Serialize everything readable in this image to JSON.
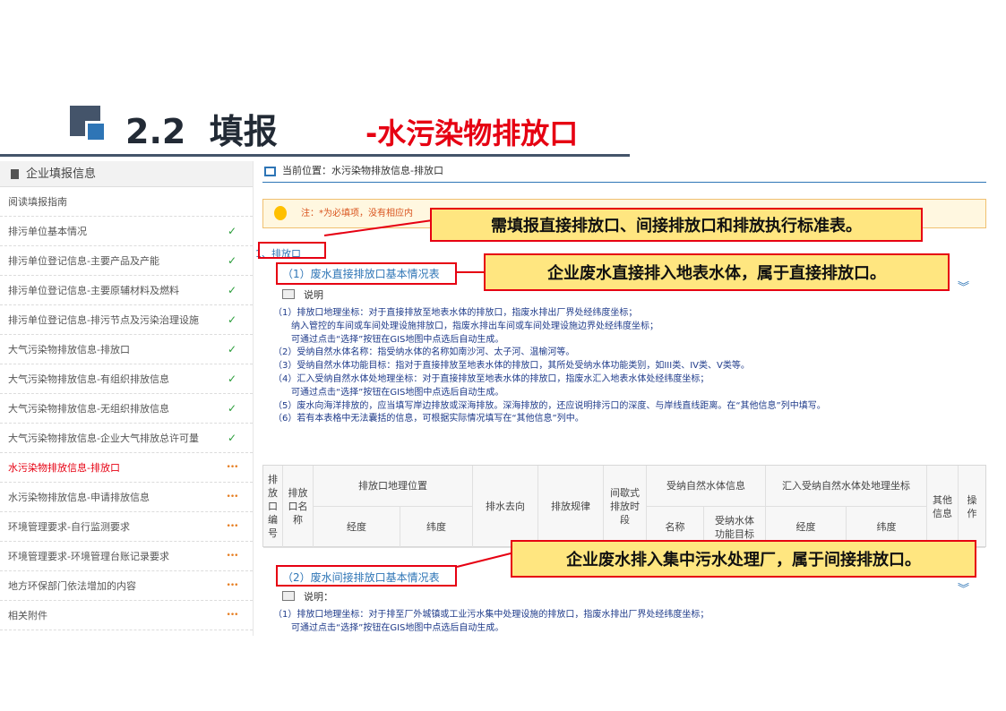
{
  "slide": {
    "number": "2.2",
    "title_main": "填报",
    "title_accent": "-水污染物排放口"
  },
  "sidebar": {
    "header": "企业填报信息",
    "items": [
      {
        "label": "阅读填报指南",
        "status": ""
      },
      {
        "label": "排污单位基本情况",
        "status": "✓"
      },
      {
        "label": "排污单位登记信息-主要产品及产能",
        "status": "✓"
      },
      {
        "label": "排污单位登记信息-主要原辅材料及燃料",
        "status": "✓"
      },
      {
        "label": "排污单位登记信息-排污节点及污染治理设施",
        "status": "✓"
      },
      {
        "label": "大气污染物排放信息-排放口",
        "status": "✓"
      },
      {
        "label": "大气污染物排放信息-有组织排放信息",
        "status": "✓"
      },
      {
        "label": "大气污染物排放信息-无组织排放信息",
        "status": "✓"
      },
      {
        "label": "大气污染物排放信息-企业大气排放总许可量",
        "status": "✓"
      },
      {
        "label": "水污染物排放信息-排放口",
        "status": "•••"
      },
      {
        "label": "水污染物排放信息-申请排放信息",
        "status": "•••"
      },
      {
        "label": "环境管理要求-自行监测要求",
        "status": "•••"
      },
      {
        "label": "环境管理要求-环境管理台账记录要求",
        "status": "•••"
      },
      {
        "label": "地方环保部门依法增加的内容",
        "status": "•••"
      },
      {
        "label": "相关附件",
        "status": "•••"
      }
    ]
  },
  "main": {
    "breadcrumb": "当前位置：水污染物排放信息-排放口",
    "notice": "注：*为必填项，没有相应内",
    "section1": "1、排放口",
    "direct_title": "（1）废水直接排放口基本情况表",
    "note_label": "说明",
    "direct_notes": [
      "（1）排放口地理坐标：对于直接排放至地表水体的排放口，指废水排出厂界处经纬度坐标；",
      "　　纳入管控的车间或车间处理设施排放口，指废水排出车间或车间处理设施边界处经纬度坐标；",
      "　　可通过点击“选择”按钮在GIS地图中点选后自动生成。",
      "（2）受纳自然水体名称：指受纳水体的名称如南沙河、太子河、温榆河等。",
      "（3）受纳自然水体功能目标：指对于直接排放至地表水体的排放口，其所处受纳水体功能类别，如III类、IV类、V类等。",
      "（4）汇入受纳自然水体处地理坐标：对于直接排放至地表水体的排放口，指废水汇入地表水体处经纬度坐标；",
      "　　可通过点击“选择”按钮在GIS地图中点选后自动生成。",
      "（5）废水向海洋排放的，应当填写岸边排放或深海排放。深海排放的，还应说明排污口的深度、与岸线直线距离。在“其他信息”列中填写。",
      "（6）若有本表格中无法囊括的信息，可根据实际情况填写在“其他信息”列中。"
    ],
    "table_headers": {
      "outlet_no": "排放口编号",
      "outlet_name": "排放口名称",
      "geo": "排放口地理位置",
      "lon": "经度",
      "lat": "纬度",
      "destination": "排水去向",
      "pattern": "排放规律",
      "intermittent": "间歇式排放时段",
      "receiving": "受纳自然水体信息",
      "recv_name": "名称",
      "recv_target": "受纳水体功能目标",
      "inflow_geo": "汇入受纳自然水体处地理坐标",
      "inflow_lon": "经度",
      "inflow_lat": "纬度",
      "other": "其他信息",
      "ops": "操作"
    },
    "indirect_title": "（2）废水间接排放口基本情况表",
    "indirect_note_label": "说明：",
    "indirect_notes": [
      "（1）排放口地理坐标：对于排至厂外城镇或工业污水集中处理设施的排放口，指废水排出厂界处经纬度坐标；",
      "　　可通过点击“选择”按钮在GIS地图中点选后自动生成。"
    ]
  },
  "callouts": {
    "c1": "需填报直接排放口、间接排放口和排放执行标准表。",
    "c2": "企业废水直接排入地表水体，属于直接排放口。",
    "c3": "企业废水排入集中污水处理厂，属于间接排放口。"
  },
  "colors": {
    "accent_red": "#e60012",
    "link_blue": "#2e75b6",
    "callout_fill": "#ffe680",
    "title_dark": "#222a35"
  }
}
